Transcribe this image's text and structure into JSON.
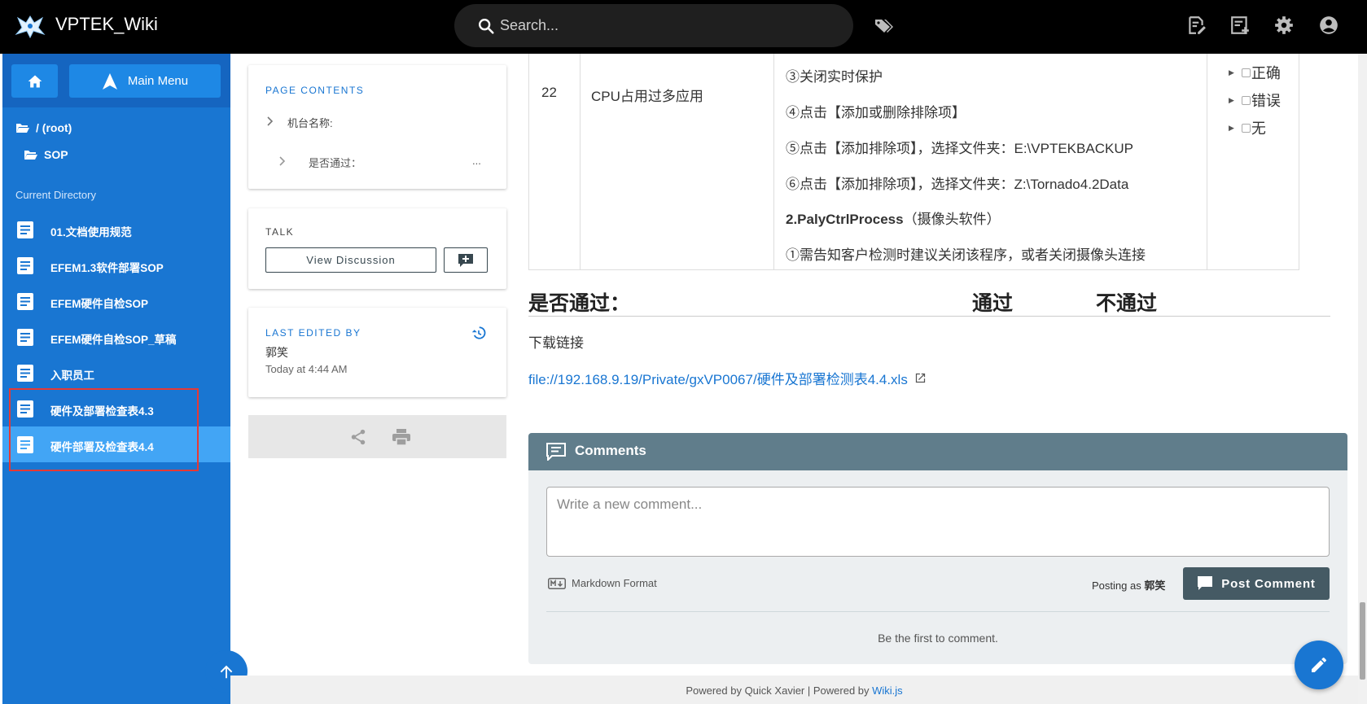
{
  "header": {
    "app_title": "VPTEK_Wiki",
    "search_placeholder": "Search..."
  },
  "sidebar": {
    "main_menu_label": "Main Menu",
    "breadcrumbs": [
      "/ (root)",
      "SOP"
    ],
    "section_label": "Current Directory",
    "items": [
      {
        "label": "01.文档使用规范"
      },
      {
        "label": "EFEM1.3软件部署SOP"
      },
      {
        "label": "EFEM硬件自检SOP"
      },
      {
        "label": "EFEM硬件自检SOP_草稿"
      },
      {
        "label": "入职员工"
      },
      {
        "label": "硬件及部署检查表4.3"
      },
      {
        "label": "硬件部署及检查表4.4"
      }
    ],
    "active_index": 6
  },
  "page_contents": {
    "title": "PAGE CONTENTS",
    "items": [
      {
        "label": "机台名称:"
      },
      {
        "label": "是否通过：",
        "suffix": "..."
      }
    ]
  },
  "talk": {
    "title": "TALK",
    "view_label": "View Discussion"
  },
  "last_edited": {
    "title": "LAST EDITED BY",
    "author": "郭笑",
    "time": "Today at 4:44 AM"
  },
  "table_row": {
    "number": "22",
    "name": "CPU占用过多应用",
    "steps": [
      "③关闭实时保护",
      "④点击【添加或删除排除项】",
      "⑤点击【添加排除项】，选择文件夹：E:\\VPTEKBACKUP",
      "⑥点击【添加排除项】，选择文件夹：Z:\\Tornado4.2Data"
    ],
    "subheading_bold": "2.PalyCtrlProcess",
    "subheading_rest": "（摄像头软件）",
    "note": "①需告知客户检测时建议关闭该程序，或者关闭摄像头连接",
    "options": [
      "正确",
      "错误",
      "无"
    ]
  },
  "result": {
    "heading": "是否通过：",
    "pass": "通过",
    "fail": "不通过"
  },
  "download": {
    "label": "下载链接",
    "link": "file://192.168.9.19/Private/gxVP0067/硬件及部署检测表4.4.xls"
  },
  "comments": {
    "title": "Comments",
    "placeholder": "Write a new comment...",
    "markdown_label": "Markdown Format",
    "posting_as_prefix": "Posting as",
    "posting_as_user": "郭笑",
    "post_button": "Post Comment",
    "empty_text": "Be the first to comment."
  },
  "footer": {
    "prefix": "Powered by Quick Xavier | Powered by",
    "link": "Wiki.js"
  },
  "colors": {
    "sidebar": "#1976d2",
    "active_item": "#42a5f5",
    "accent": "#1976d2",
    "comments_header": "#607d8b",
    "highlight_box": "#e53935"
  }
}
